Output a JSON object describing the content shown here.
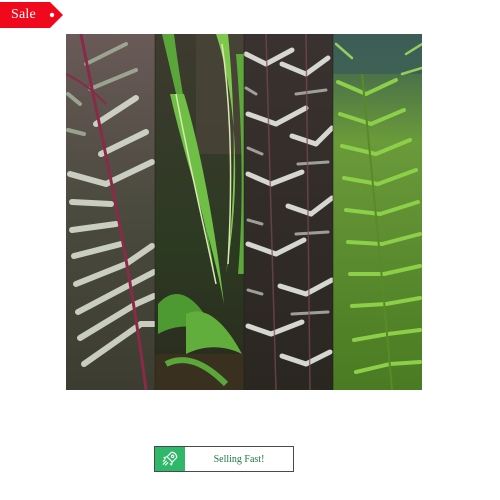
{
  "sale_tag": {
    "label": "Sale",
    "color": "#f0081c",
    "icon": "tag-icon"
  },
  "product_image": {
    "icon": "fern-collection-photo",
    "panels": [
      "red-veined-fern",
      "harts-tongue-fern",
      "japanese-painted-fern",
      "lady-fern"
    ]
  },
  "selling_badge": {
    "label": "Selling Fast!",
    "icon": "rocket-icon",
    "icon_bg": "#2fb86a",
    "text_color": "#1e7a43"
  }
}
